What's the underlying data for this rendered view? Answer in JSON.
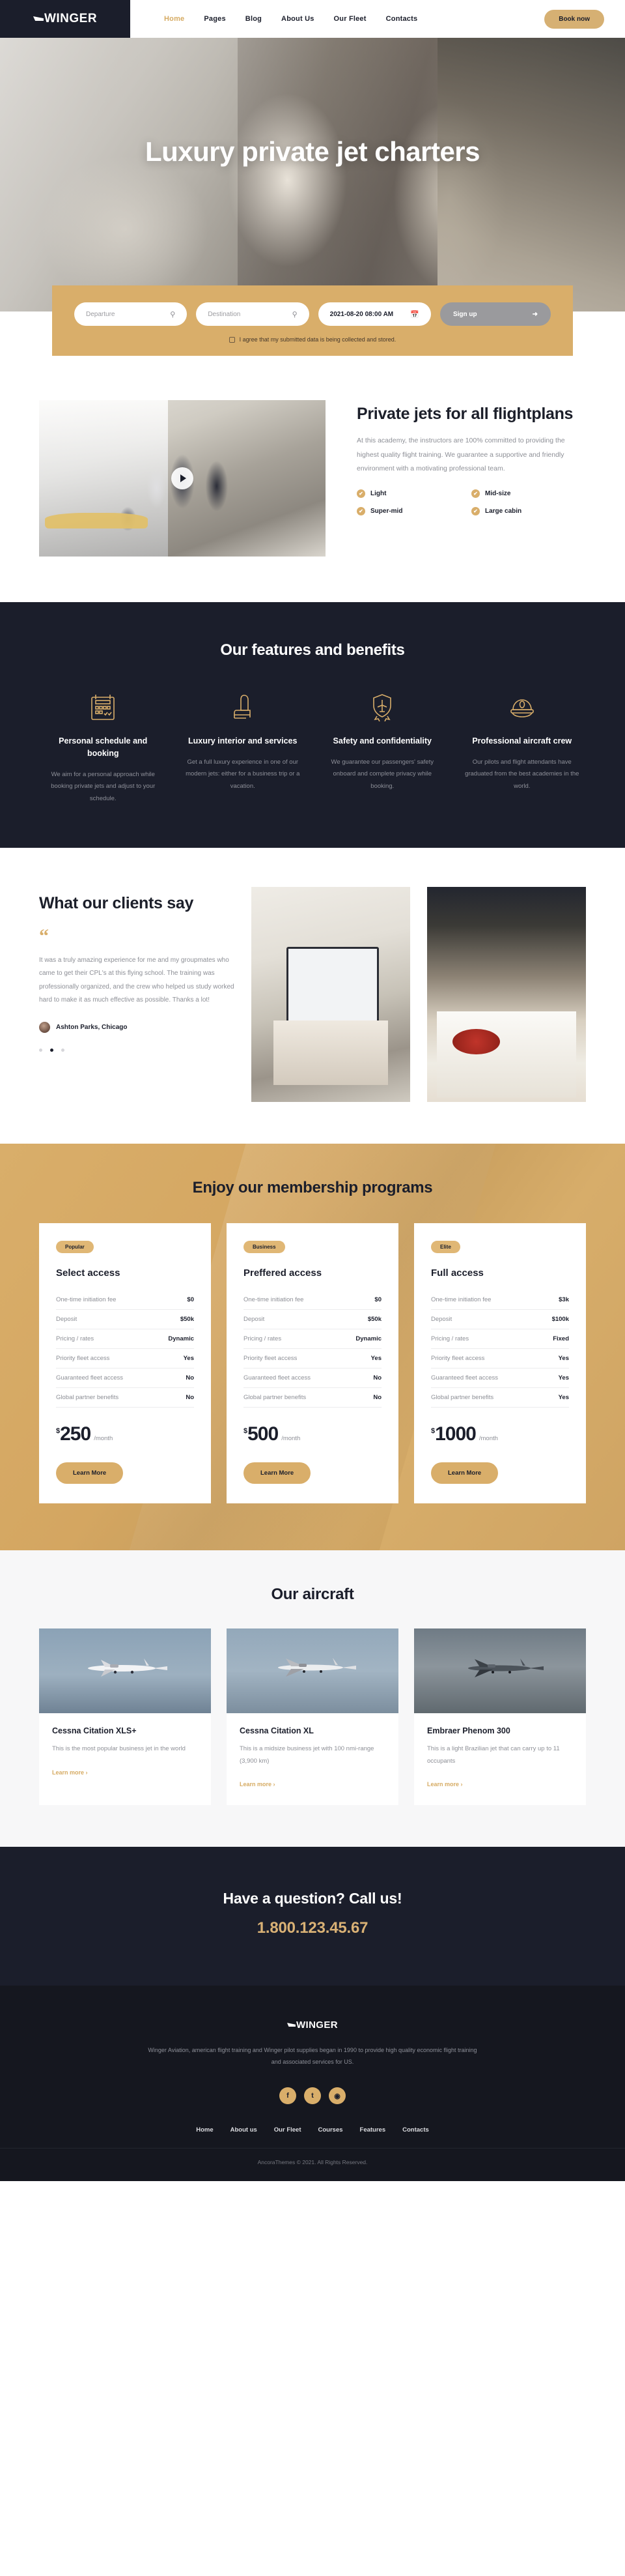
{
  "brand": {
    "name": "WINGER"
  },
  "header": {
    "nav": [
      {
        "label": "Home",
        "active": true
      },
      {
        "label": "Pages",
        "active": false
      },
      {
        "label": "Blog",
        "active": false
      },
      {
        "label": "About Us",
        "active": false
      },
      {
        "label": "Our Fleet",
        "active": false
      },
      {
        "label": "Contacts",
        "active": false
      }
    ],
    "cta_label": "Book now"
  },
  "hero": {
    "title": "Luxury private jet charters"
  },
  "booking": {
    "departure_placeholder": "Departure",
    "destination_placeholder": "Destination",
    "date_value": "2021-08-20 08:00 AM",
    "submit_label": "Sign up",
    "submit_icon": "plane-icon",
    "consent_text": "I agree that my submitted data is being collected and stored."
  },
  "about": {
    "title": "Private jets for all flightplans",
    "description": "At this academy, the instructors are 100% committed to providing the highest quality flight training. We guarantee a supportive and friendly environment with a motivating professional team.",
    "items": [
      {
        "label": "Light"
      },
      {
        "label": "Mid-size"
      },
      {
        "label": "Super-mid"
      },
      {
        "label": "Large cabin"
      }
    ],
    "check_glyph": "✔"
  },
  "features": {
    "title": "Our features and benefits",
    "items": [
      {
        "icon": "calendar-icon",
        "title": "Personal schedule and booking",
        "text": "We aim for a personal approach while booking private jets and adjust to your schedule."
      },
      {
        "icon": "seat-icon",
        "title": "Luxury interior and services",
        "text": "Get a full luxury experience in one of our modern jets: either for a business trip or a vacation."
      },
      {
        "icon": "shield-plane-icon",
        "title": "Safety and confidentiality",
        "text": "We guarantee our passengers' safety onboard and complete privacy while booking."
      },
      {
        "icon": "pilot-cap-icon",
        "title": "Professional aircraft crew",
        "text": "Our pilots and flight attendants have graduated from the best academies in the world."
      }
    ]
  },
  "testimonials": {
    "title": "What our clients say",
    "quote_glyph": "“",
    "text": "It was a truly amazing experience for me and my groupmates who came to get their CPL's at this flying school. The training was professionally organized, and the crew who helped us study worked hard to make it as much effective as possible. Thanks a lot!",
    "author": "Ashton Parks, Chicago",
    "dots": [
      {
        "active": false
      },
      {
        "active": true
      },
      {
        "active": false
      }
    ]
  },
  "pricing": {
    "title": "Enjoy our membership programs",
    "feature_labels": [
      "One-time initiation fee",
      "Deposit",
      "Pricing / rates",
      "Priority fleet access",
      "Guaranteed fleet access",
      "Global partner benefits"
    ],
    "currency": "$",
    "period": "/month",
    "button_label": "Learn More",
    "plans": [
      {
        "badge": "Popular",
        "name": "Select access",
        "values": [
          "$0",
          "$50k",
          "Dynamic",
          "Yes",
          "No",
          "No"
        ],
        "price": "250"
      },
      {
        "badge": "Business",
        "name": "Preffered access",
        "values": [
          "$0",
          "$50k",
          "Dynamic",
          "Yes",
          "No",
          "No"
        ],
        "price": "500"
      },
      {
        "badge": "Elite",
        "name": "Full access",
        "values": [
          "$3k",
          "$100k",
          "Fixed",
          "Yes",
          "Yes",
          "Yes"
        ],
        "price": "1000"
      }
    ]
  },
  "aircraft": {
    "title": "Our aircraft",
    "link_label": "Learn more ›",
    "items": [
      {
        "name": "Cessna Citation XLS+",
        "desc": "This is the most popular business jet in the world"
      },
      {
        "name": "Cessna Citation XL",
        "desc": "This is a midsize business jet with 100 nmi-range (3,900 km)"
      },
      {
        "name": "Embraer Phenom 300",
        "desc": "This is a light Brazilian jet that can carry up to 11 occupants"
      }
    ]
  },
  "cta": {
    "title": "Have a question? Call us!",
    "phone": "1.800.123.45.67"
  },
  "footer": {
    "about": "Winger Aviation, american flight training and Winger pilot supplies began in 1990 to provide high quality economic flight training and associated services for US.",
    "socials": [
      {
        "icon": "facebook-icon",
        "glyph": "f"
      },
      {
        "icon": "twitter-icon",
        "glyph": "t"
      },
      {
        "icon": "instagram-icon",
        "glyph": "◉"
      }
    ],
    "nav": [
      {
        "label": "Home"
      },
      {
        "label": "About us"
      },
      {
        "label": "Our Fleet"
      },
      {
        "label": "Courses"
      },
      {
        "label": "Features"
      },
      {
        "label": "Contacts"
      }
    ],
    "copyright": "AncoraThemes © 2021. All Rights Reserved."
  },
  "colors": {
    "accent": "#d9ae6a",
    "dark": "#1b1e2b",
    "footer_dark": "#15171f",
    "muted": "#8d8f96"
  }
}
